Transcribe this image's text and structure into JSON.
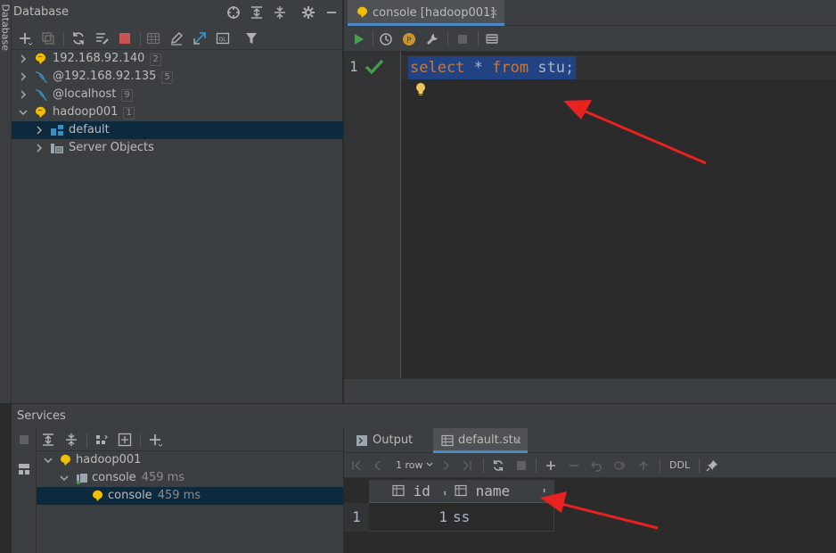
{
  "sidebar": {
    "label": "Database"
  },
  "db_panel": {
    "title": "Database",
    "tree": [
      {
        "label": "192.168.92.140",
        "badge": "2"
      },
      {
        "label": "@192.168.92.135",
        "badge": "5"
      },
      {
        "label": "@localhost",
        "badge": "9"
      },
      {
        "label": "hadoop001",
        "badge": "1"
      },
      {
        "label": "default"
      },
      {
        "label": "Server Objects"
      }
    ]
  },
  "editor": {
    "tab_label": "console [hadoop001]",
    "line_number": "1",
    "code": {
      "kw_select": "select",
      "star": " * ",
      "kw_from": "from",
      "rest": " stu;"
    }
  },
  "services": {
    "title": "Services",
    "tree": [
      {
        "label": "hadoop001"
      },
      {
        "label": "console",
        "time": "459 ms"
      },
      {
        "label": "console",
        "time": "459 ms"
      }
    ]
  },
  "results": {
    "tabs": {
      "output": "Output",
      "stu": "default.stu"
    },
    "row_count": "1 row",
    "ddl_label": "DDL",
    "columns": [
      "id",
      "name"
    ],
    "rows": [
      {
        "row_no": "1",
        "id": "1",
        "name": "ss"
      }
    ]
  },
  "colors": {
    "accent": "#4a88c7",
    "selection": "#214283",
    "keyword": "#cc7832",
    "arrow": "#e8221f"
  }
}
